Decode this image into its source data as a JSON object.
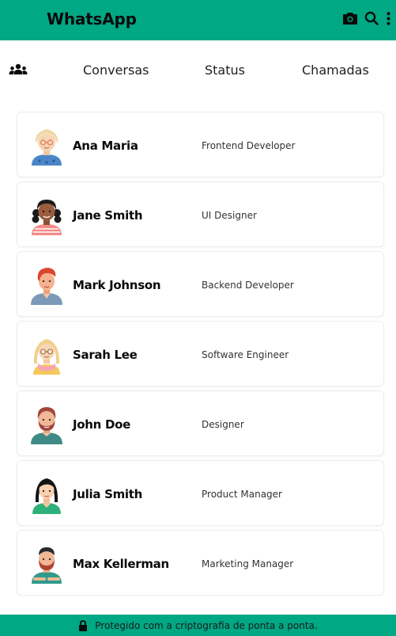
{
  "header": {
    "title": "WhatsApp",
    "icons": [
      "camera-icon",
      "search-icon",
      "more-vertical-icon"
    ],
    "brand_color": "#00a884"
  },
  "tabs": {
    "community_icon": "users-icon",
    "items": [
      {
        "label": "Conversas"
      },
      {
        "label": "Status"
      },
      {
        "label": "Chamadas"
      }
    ]
  },
  "contacts": [
    {
      "name": "Ana Maria",
      "role": "Frontend Developer",
      "avatar": "blonde-woman-glasses-avatar"
    },
    {
      "name": "Jane Smith",
      "role": "UI Designer",
      "avatar": "curly-hair-woman-avatar"
    },
    {
      "name": "Mark Johnson",
      "role": "Backend Developer",
      "avatar": "red-hair-man-avatar"
    },
    {
      "name": "Sarah Lee",
      "role": "Software Engineer",
      "avatar": "blonde-woman-scarf-avatar"
    },
    {
      "name": "John Doe",
      "role": "Designer",
      "avatar": "bearded-man-avatar"
    },
    {
      "name": "Julia Smith",
      "role": "Product Manager",
      "avatar": "dark-hair-woman-avatar"
    },
    {
      "name": "Max Kellerman",
      "role": "Marketing Manager",
      "avatar": "bearded-man-tattoo-avatar"
    }
  ],
  "footer": {
    "text": "Protegido com a criptografia de ponta a ponta.",
    "icon": "lock-icon"
  }
}
